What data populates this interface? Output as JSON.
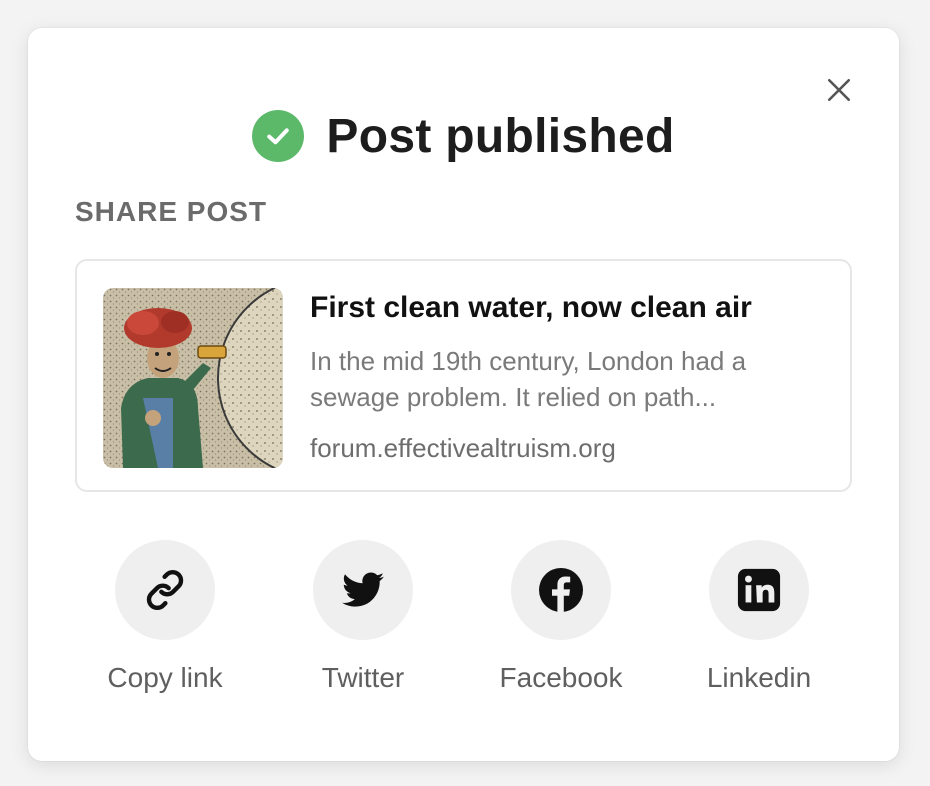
{
  "dialog": {
    "title": "Post published",
    "status_icon": "check-circle-icon",
    "close_icon": "close-icon",
    "success_color": "#5cb96a"
  },
  "share": {
    "section_label": "SHARE POST",
    "card": {
      "title": "First clean water, now clean air",
      "excerpt_line1": "In the mid 19th century, London had a",
      "excerpt_line2": "sewage problem. It relied on path...",
      "domain": "forum.effectivealtruism.org",
      "thumbnail": "vintage-illustration-thumbnail"
    },
    "options": [
      {
        "label": "Copy link",
        "icon": "link-icon"
      },
      {
        "label": "Twitter",
        "icon": "twitter-icon"
      },
      {
        "label": "Facebook",
        "icon": "facebook-icon"
      },
      {
        "label": "Linkedin",
        "icon": "linkedin-icon"
      }
    ]
  }
}
